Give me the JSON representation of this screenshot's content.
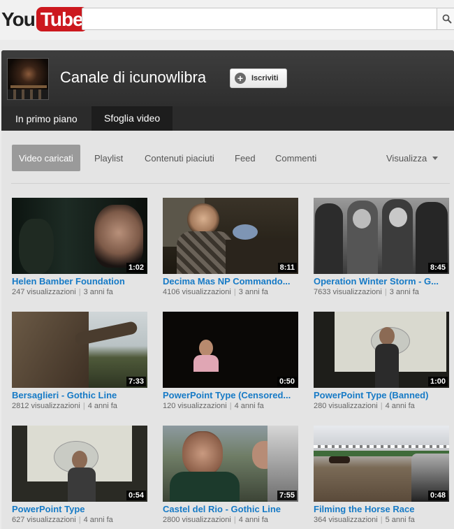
{
  "masthead": {
    "logo_you": "You",
    "logo_tube": "Tube",
    "search_placeholder": ""
  },
  "channel": {
    "title": "Canale di icunowlibra",
    "subscribe_label": "Iscriviti",
    "tabs": [
      {
        "label": "In primo piano"
      },
      {
        "label": "Sfoglia video"
      }
    ]
  },
  "subnav": {
    "items": [
      {
        "label": "Video caricati"
      },
      {
        "label": "Playlist"
      },
      {
        "label": "Contenuti piaciuti"
      },
      {
        "label": "Feed"
      },
      {
        "label": "Commenti"
      }
    ],
    "view_label": "Visualizza"
  },
  "videos": [
    {
      "title": "Helen Bamber Foundation",
      "duration": "1:02",
      "views": "247 visualizzazioni",
      "age": "3 anni fa"
    },
    {
      "title": "Decima Mas NP Commando...",
      "duration": "8:11",
      "views": "4106 visualizzazioni",
      "age": "3 anni fa"
    },
    {
      "title": "Operation Winter Storm - G...",
      "duration": "8:45",
      "views": "7633 visualizzazioni",
      "age": "3 anni fa"
    },
    {
      "title": "Bersaglieri - Gothic Line",
      "duration": "7:33",
      "views": "2812 visualizzazioni",
      "age": "4 anni fa"
    },
    {
      "title": "PowerPoint Type (Censored...",
      "duration": "0:50",
      "views": "120 visualizzazioni",
      "age": "4 anni fa"
    },
    {
      "title": "PowerPoint Type (Banned)",
      "duration": "1:00",
      "views": "280 visualizzazioni",
      "age": "4 anni fa"
    },
    {
      "title": "PowerPoint Type",
      "duration": "0:54",
      "views": "627 visualizzazioni",
      "age": "4 anni fa"
    },
    {
      "title": "Castel del Rio - Gothic Line",
      "duration": "7:55",
      "views": "2800 visualizzazioni",
      "age": "4 anni fa"
    },
    {
      "title": "Filming the Horse Race",
      "duration": "0:48",
      "views": "364 visualizzazioni",
      "age": "5 anni fa"
    }
  ],
  "colors": {
    "link": "#167ac6",
    "header": "#2b2b2b",
    "brand_red": "#cc181e"
  }
}
